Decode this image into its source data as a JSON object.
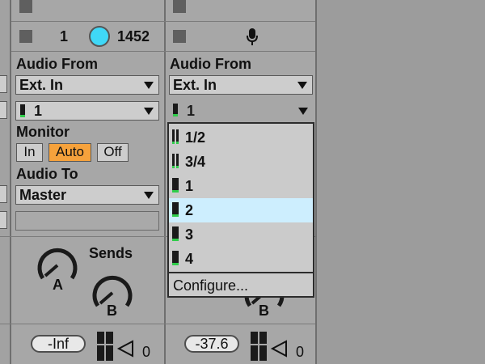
{
  "colors": {
    "background": "#9c9c9c",
    "track": "#a7a7a7",
    "monitor_active": "#f6a23c",
    "selected_item": "#cdeefe",
    "level_green": "#2fcc4a",
    "cyan_dot": "#3fd8f7"
  },
  "track1": {
    "number": "1",
    "value": "1452",
    "audio_from_label": "Audio From",
    "input_type": "Ext. In",
    "input_channel": "1",
    "monitor_label": "Monitor",
    "monitor": {
      "in": "In",
      "auto": "Auto",
      "off": "Off",
      "active": "Auto"
    },
    "audio_to_label": "Audio To",
    "output": "Master",
    "sends_label": "Sends",
    "send_a": "A",
    "send_b": "B",
    "volume": "-Inf",
    "pan_value": "0"
  },
  "track2": {
    "icon": "microphone-icon",
    "audio_from_label": "Audio From",
    "input_type": "Ext. In",
    "input_channel": "1",
    "send_b": "B",
    "volume": "-37.6",
    "pan_value": "0"
  },
  "input_menu": {
    "items": [
      {
        "label": "1/2",
        "stereo": true
      },
      {
        "label": "3/4",
        "stereo": true
      },
      {
        "label": "1",
        "stereo": false
      },
      {
        "label": "2",
        "stereo": false
      },
      {
        "label": "3",
        "stereo": false
      },
      {
        "label": "4",
        "stereo": false
      }
    ],
    "selected": "2",
    "configure": "Configure..."
  }
}
